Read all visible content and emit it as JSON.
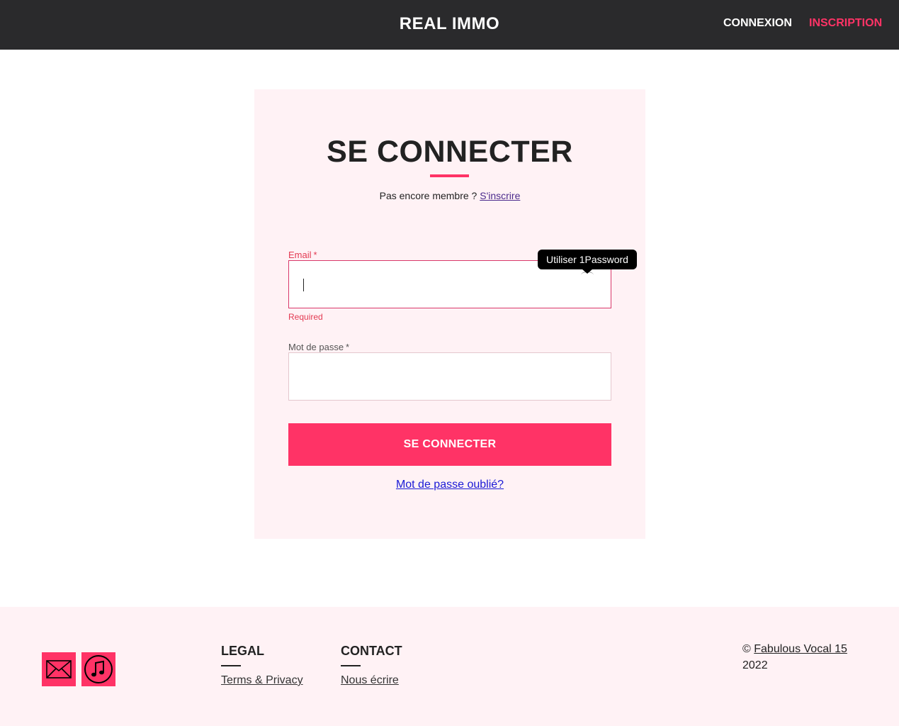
{
  "header": {
    "brand": "REAL IMMO",
    "nav": {
      "login": "CONNEXION",
      "signup": "INSCRIPTION"
    }
  },
  "login": {
    "title": "SE CONNECTER",
    "not_member": "Pas encore membre ?",
    "signup_link": "S'inscrire",
    "email": {
      "label": "Email",
      "required_mark": "*",
      "value": "",
      "error": "Required"
    },
    "password": {
      "label": "Mot de passe",
      "required_mark": "*",
      "value": ""
    },
    "tooltip": "Utiliser 1Password",
    "submit": "SE CONNECTER",
    "forgot": "Mot de passe oublié?"
  },
  "footer": {
    "social": [
      {
        "icon": "mail-icon"
      },
      {
        "icon": "music-note-icon"
      }
    ],
    "legal": {
      "heading": "LEGAL",
      "link": "Terms & Privacy"
    },
    "contact": {
      "heading": "CONTACT",
      "link": "Nous écrire"
    },
    "copyright": {
      "symbol": "©",
      "link": "Fabulous Vocal 15",
      "year": "2022"
    }
  },
  "colors": {
    "accent": "#ff3366",
    "header_bg": "#2a2a2c",
    "panel_bg": "#fff2f5",
    "error": "#e33a52"
  }
}
